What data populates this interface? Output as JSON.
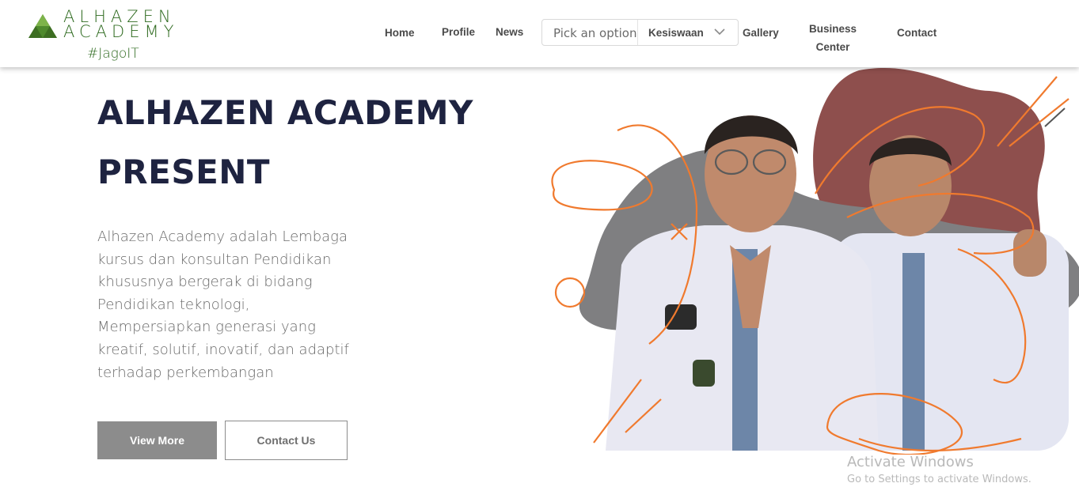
{
  "brand": {
    "logo_line1": "ALHAZEN",
    "logo_line2": "ACADEMY",
    "tagline": "#JagoIT",
    "logo_icon": "triangle-logo-icon",
    "color": "#2e6a1f"
  },
  "nav": {
    "home": "Home",
    "profile": "Profile",
    "news": "News",
    "select_placeholder": "Pick an option",
    "select_value": "Kesiswaan",
    "gallery": "Gallery",
    "business_line1": "Business",
    "business_line2": "Center",
    "contact": "Contact"
  },
  "hero": {
    "title_line1": "ALHAZEN ACADEMY",
    "title_line2": "PRESENT",
    "description": "Alhazen Academy adalah Lembaga kursus dan konsultan Pendidikan khususnya bergerak di bidang Pendidikan teknologi, Mempersiapkan generasi yang kreatif, solutif, inovatif, dan adaptif terhadap perkembangan",
    "btn_primary": "View More",
    "btn_secondary": "Contact Us"
  },
  "watermark": {
    "title": "Activate Windows",
    "subtitle": "Go to Settings to activate Windows."
  },
  "colors": {
    "title": "#1e2340",
    "accent_orange": "#f07a2e",
    "blob_gray": "#7f7f81",
    "blob_brown": "#8e4f4d",
    "button_gray": "#8c8c8c"
  }
}
